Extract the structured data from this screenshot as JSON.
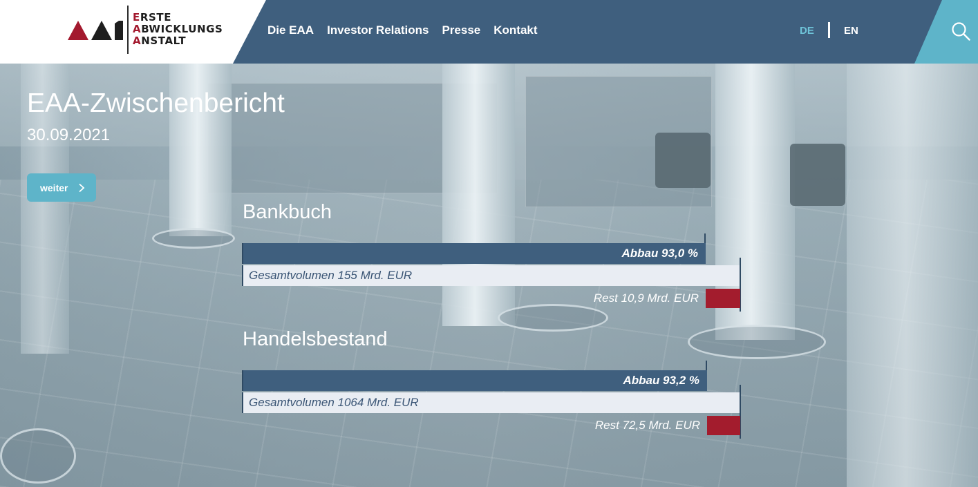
{
  "brand": {
    "logo_lines": [
      "ERSTE",
      "ABWICKLUNGS",
      "ANSTALT"
    ],
    "accent_red": "#a3192e",
    "nav_blue": "#3f5f7e",
    "accent_cyan": "#5eb4c9"
  },
  "nav": {
    "items": [
      {
        "label": "Die EAA"
      },
      {
        "label": "Investor Relations"
      },
      {
        "label": "Presse"
      },
      {
        "label": "Kontakt"
      }
    ]
  },
  "language": {
    "options": [
      "DE",
      "EN"
    ],
    "active": "DE"
  },
  "search": {
    "icon": "search-icon"
  },
  "hero": {
    "title": "EAA-Zwischenbericht",
    "date": "30.09.2021",
    "button_label": "weiter",
    "button_icon": "chevron-right-icon"
  },
  "reports": [
    {
      "title": "Bankbuch",
      "abbau_label": "Abbau 93,0 %",
      "abbau_fraction": 0.93,
      "total_label": "Gesamtvolumen 155 Mrd. EUR",
      "rest_label": "Rest 10,9 Mrd. EUR"
    },
    {
      "title": "Handelsbestand",
      "abbau_label": "Abbau 93,2 %",
      "abbau_fraction": 0.932,
      "total_label": "Gesamtvolumen 1064 Mrd. EUR",
      "rest_label": "Rest 72,5 Mrd. EUR"
    }
  ]
}
